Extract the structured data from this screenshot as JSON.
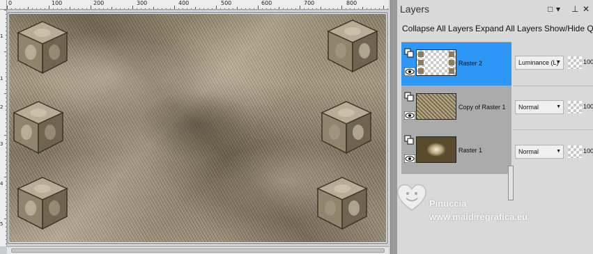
{
  "ruler": {
    "top_numbers": [
      "0",
      "100",
      "200",
      "300",
      "400",
      "500",
      "600",
      "700",
      "800"
    ],
    "left_numbers": [
      "1",
      "1",
      "2",
      "3",
      "4",
      "5"
    ]
  },
  "layers_panel": {
    "title": "Layers",
    "header_buttons": {
      "restore": "□",
      "menu": "▾",
      "pin": "⊥",
      "close": "✕"
    },
    "toolbar": {
      "collapse_all": "Collapse All Layers",
      "expand_all": "Expand All Layers",
      "show_hide": "Show/Hide Q"
    },
    "layers": [
      {
        "name": "Raster 2",
        "blend_mode": "Luminance (L)",
        "opacity": "100",
        "selected": true
      },
      {
        "name": "Copy of Raster 1",
        "blend_mode": "Normal",
        "opacity": "100",
        "selected": false
      },
      {
        "name": "Raster 1",
        "blend_mode": "Normal",
        "opacity": "100",
        "selected": false
      }
    ]
  },
  "watermark": {
    "name": "Pinuccia",
    "url": "www.maidiregrafica.eu"
  },
  "colors": {
    "selected_layer": "#2e96f5",
    "panel_bg": "#d9d9d9",
    "layer_bg": "#ababab"
  }
}
